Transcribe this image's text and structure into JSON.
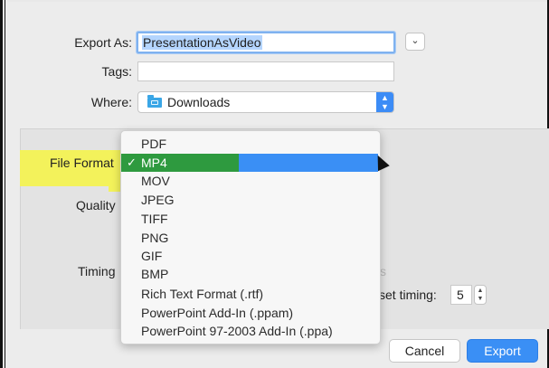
{
  "dialog": {
    "export_as_label": "Export As:",
    "export_as_value": "PresentationAsVideo",
    "tags_label": "Tags:",
    "tags_value": "",
    "where_label": "Where:",
    "where_value": "Downloads",
    "expand_icon": "chevron-down-icon",
    "folder_icon": "folder-icon"
  },
  "options": {
    "file_format_label": "File Format",
    "quality_label": "Quality",
    "timing_label": "Timing",
    "timing_suffix": "s",
    "set_timing_label": "set timing:",
    "set_timing_value": "5"
  },
  "format_menu": {
    "items": [
      {
        "label": "PDF",
        "selected": false
      },
      {
        "label": "MP4",
        "selected": true
      },
      {
        "label": "MOV",
        "selected": false
      },
      {
        "label": "JPEG",
        "selected": false
      },
      {
        "label": "TIFF",
        "selected": false
      },
      {
        "label": "PNG",
        "selected": false
      },
      {
        "label": "GIF",
        "selected": false
      },
      {
        "label": "BMP",
        "selected": false
      },
      {
        "label": "Rich Text Format (.rtf)",
        "selected": false
      },
      {
        "label": "PowerPoint Add-In (.ppam)",
        "selected": false
      },
      {
        "label": "PowerPoint 97-2003 Add-In (.ppa)",
        "selected": false
      }
    ],
    "check_mark": "✓",
    "highlight_color": "#3a8ff5"
  },
  "buttons": {
    "cancel": "Cancel",
    "export": "Export"
  },
  "colors": {
    "accent": "#3a8ff5",
    "annotation_yellow": "#f3f25b",
    "annotation_green": "#2e9a3f"
  }
}
